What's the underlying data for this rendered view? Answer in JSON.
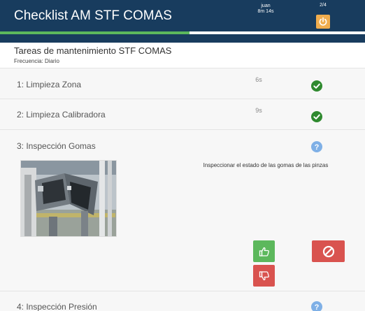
{
  "header": {
    "title": "Checklist AM STF COMAS",
    "user_name": "juan",
    "elapsed": "8m 14s",
    "step_counter": "2/4",
    "power_icon": "power-icon"
  },
  "progress": {
    "fraction": 0.52,
    "color": "#5cb85c"
  },
  "section": {
    "title": "Tareas de mantenimiento STF COMAS",
    "frequency": "Frecuencia: Diario"
  },
  "tasks": [
    {
      "label": "1: Limpieza Zona",
      "time": "6s",
      "status": "done",
      "icon": "check-circle-icon"
    },
    {
      "label": "2: Limpieza Calibradora",
      "time": "9s",
      "status": "done",
      "icon": "check-circle-icon"
    },
    {
      "label": "3: Inspección Gomas",
      "time": "",
      "status": "pending",
      "icon": "question-circle-icon",
      "instruction": "Inspeccionar el estado de las gomas de las pinzas"
    },
    {
      "label": "4: Inspección Presión",
      "time": "",
      "status": "pending",
      "icon": "question-circle-icon"
    }
  ],
  "actions": {
    "ok_icon": "thumbs-up-icon",
    "nok_icon": "thumbs-down-icon",
    "skip_icon": "ban-icon"
  },
  "colors": {
    "header_bg": "#183c5e",
    "success": "#5cb85c",
    "danger": "#d9534f",
    "warning": "#f0ad4e",
    "info": "#5bc0de"
  }
}
